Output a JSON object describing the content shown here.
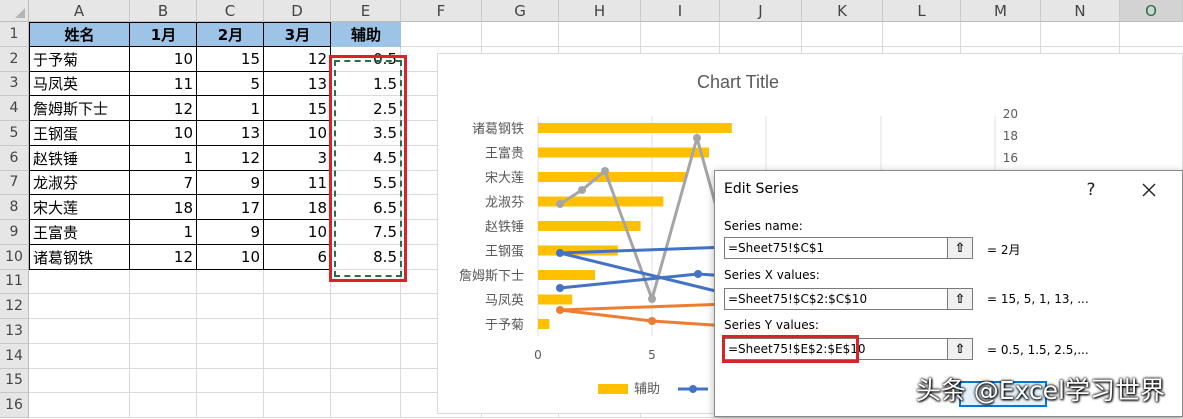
{
  "columns": [
    "A",
    "B",
    "C",
    "D",
    "E",
    "F",
    "G",
    "H",
    "I",
    "J",
    "K",
    "L",
    "M",
    "N",
    "O"
  ],
  "rows": [
    "1",
    "2",
    "3",
    "4",
    "5",
    "6",
    "7",
    "8",
    "9",
    "10",
    "11",
    "12",
    "13",
    "14",
    "15",
    "16"
  ],
  "table": {
    "headers": [
      "姓名",
      "1月",
      "2月",
      "3月",
      "辅助"
    ],
    "data": [
      [
        "于予菊",
        "10",
        "15",
        "12",
        "0.5"
      ],
      [
        "马凤英",
        "11",
        "5",
        "13",
        "1.5"
      ],
      [
        "詹姆斯下士",
        "12",
        "1",
        "15",
        "2.5"
      ],
      [
        "王钢蛋",
        "10",
        "13",
        "10",
        "3.5"
      ],
      [
        "赵铁锤",
        "1",
        "12",
        "3",
        "4.5"
      ],
      [
        "龙淑芬",
        "7",
        "9",
        "11",
        "5.5"
      ],
      [
        "宋大莲",
        "18",
        "17",
        "18",
        "6.5"
      ],
      [
        "王富贵",
        "1",
        "9",
        "10",
        "7.5"
      ],
      [
        "诸葛钢铁",
        "12",
        "10",
        "6",
        "8.5"
      ]
    ]
  },
  "chart": {
    "title": "Chart Title",
    "y_categories": [
      "诸葛钢铁",
      "王富贵",
      "宋大莲",
      "龙淑芬",
      "赵铁锤",
      "王钢蛋",
      "詹姆斯下士",
      "马凤英",
      "于予菊"
    ],
    "x_ticks": [
      "0",
      "5"
    ],
    "sec_ticks": [
      "20",
      "18",
      "16"
    ],
    "legend_bar": "辅助"
  },
  "chart_data": {
    "type": "bar",
    "title": "Chart Title",
    "categories": [
      "于予菊",
      "马凤英",
      "詹姆斯下士",
      "王钢蛋",
      "赵铁锤",
      "龙淑芬",
      "宋大莲",
      "王富贵",
      "诸葛钢铁"
    ],
    "series": [
      {
        "name": "辅助",
        "values": [
          0.5,
          1.5,
          2.5,
          3.5,
          4.5,
          5.5,
          6.5,
          7.5,
          8.5
        ]
      },
      {
        "name": "1月",
        "values": [
          10,
          11,
          12,
          10,
          1,
          7,
          18,
          1,
          12
        ]
      },
      {
        "name": "2月",
        "values": [
          15,
          5,
          1,
          13,
          12,
          9,
          17,
          9,
          10
        ]
      },
      {
        "name": "3月",
        "values": [
          12,
          13,
          15,
          10,
          3,
          11,
          18,
          10,
          6
        ]
      }
    ],
    "colors": {
      "bar": "#ffc000",
      "s1": "#ed7d31",
      "s2": "#a5a5a5",
      "s3": "#4472c4"
    }
  },
  "dialog": {
    "title": "Edit Series",
    "help": "?",
    "close": "✕",
    "name_label": "Series name:",
    "name_value": "=Sheet75!$C$1",
    "name_result": "= 2月",
    "x_label": "Series X values:",
    "x_value": "=Sheet75!$C$2:$C$10",
    "x_result": "= 15, 5, 1, 13, ...",
    "y_label": "Series Y values:",
    "y_value": "=Sheet75!$E$2:$E$10",
    "y_result": "= 0.5, 1.5, 2.5,..."
  },
  "watermark": "头条 @Excel学习世界"
}
